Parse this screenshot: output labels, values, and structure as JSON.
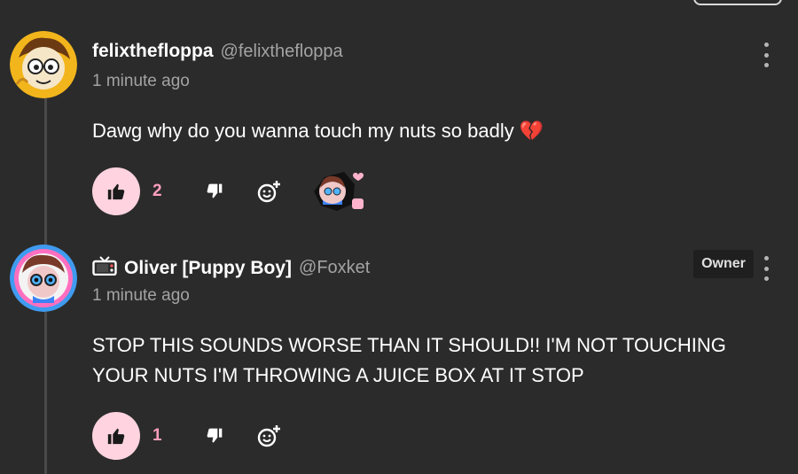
{
  "comments": [
    {
      "author": "felixthefloppa",
      "handle": "@felixthefloppa",
      "time": "1 minute ago",
      "text": "Dawg why do you wanna touch my nuts so badly 💔",
      "likes": "2",
      "has_creator_heart": true
    },
    {
      "author": "Oliver [Puppy Boy]",
      "handle": "@Foxket",
      "time": "1 minute ago",
      "badge": "Owner",
      "text_line1": "STOP THIS SOUNDS WORSE THAN IT SHOULD!! I'M NOT TOUCHING",
      "text_line2": "YOUR NUTS I'M THROWING A JUICE BOX AT IT STOP",
      "likes": "1"
    }
  ],
  "icons": {
    "like": "thumbs-up-icon",
    "dislike": "thumbs-down-icon",
    "react": "add-reaction-icon",
    "more": "more-vertical-icon",
    "tv": "tv-icon"
  },
  "colors": {
    "background": "#2b2b2b",
    "like_pill": "#ffd3e0",
    "accent_pink": "#ff9fbe",
    "muted_text": "#a3a3a3"
  }
}
